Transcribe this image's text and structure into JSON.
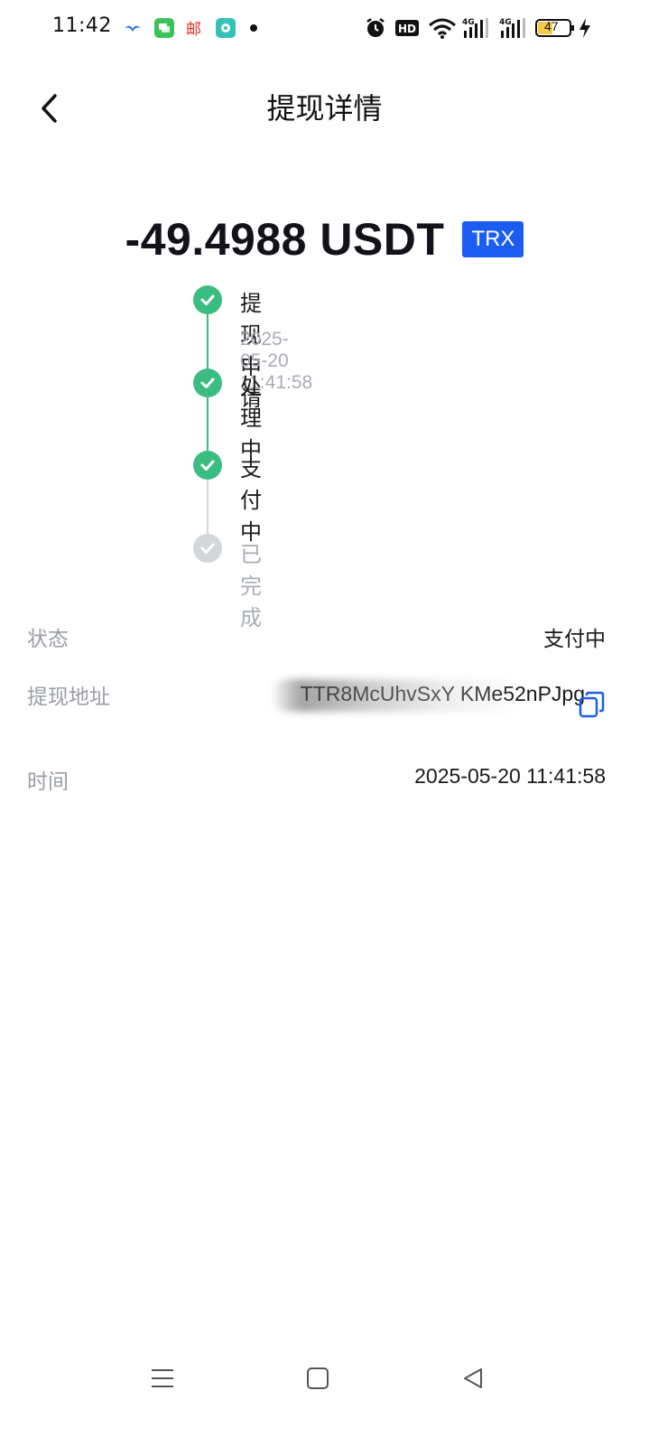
{
  "status_bar": {
    "time": "11:42",
    "battery": "47",
    "network": "4G",
    "icons": [
      "bird-app-icon",
      "message-app-icon",
      "mail-app-icon",
      "chat-app-icon",
      "dot-icon",
      "alarm-icon",
      "hd-icon",
      "wifi-icon",
      "signal-icon",
      "signal-icon",
      "battery-icon",
      "charging-icon"
    ]
  },
  "header": {
    "title": "提现详情"
  },
  "amount": {
    "value": "-49.4988 USDT",
    "network_badge": "TRX",
    "badge_color": "#1c5df1"
  },
  "timeline": {
    "active_color": "#3cbd80",
    "inactive_color": "#d3d6db",
    "steps": [
      {
        "label": "提现申请",
        "time": "2025-05-20 11:41:58",
        "done": true
      },
      {
        "label": "处理中",
        "time": "",
        "done": true
      },
      {
        "label": "支付中",
        "time": "",
        "done": true
      },
      {
        "label": "已完成",
        "time": "",
        "done": false
      }
    ]
  },
  "details": {
    "status_label": "状态",
    "status_value": "支付中",
    "address_label": "提现地址",
    "address_value": "TTR8McUhvSxY                    KMe52nPJpg",
    "time_label": "时间",
    "time_value": "2025-05-20 11:41:58"
  },
  "nav": {
    "items": [
      "menu-icon",
      "home-icon",
      "back-triangle-icon"
    ]
  }
}
